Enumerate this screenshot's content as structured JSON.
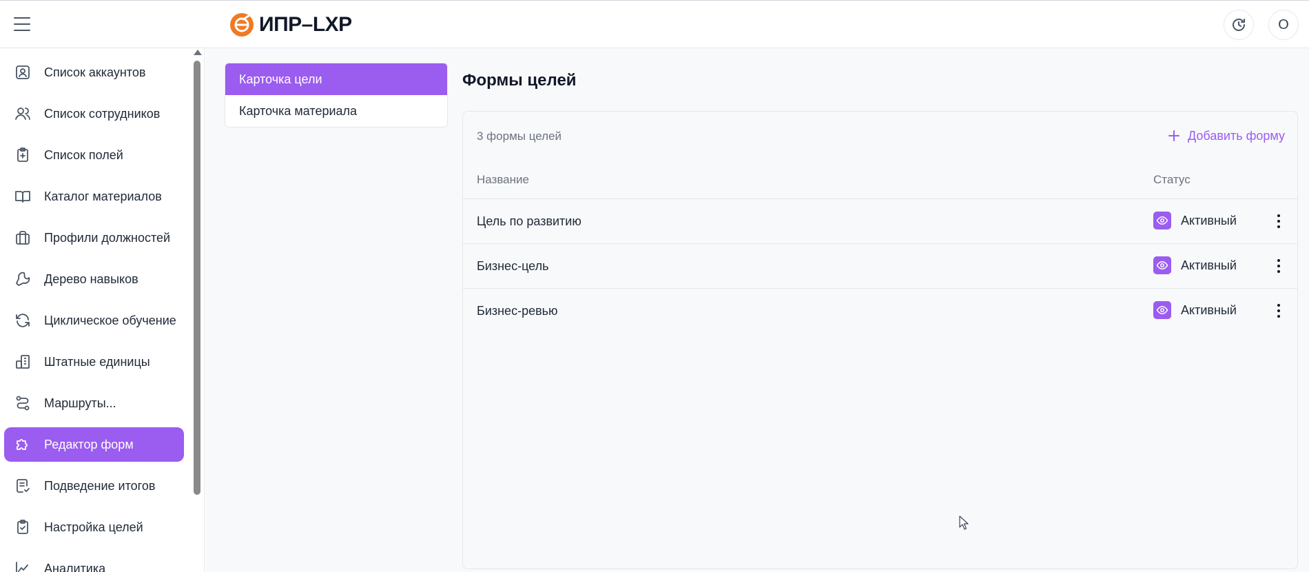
{
  "header": {
    "app_name": "ИПР–LXP",
    "brand_color": "#f07a24",
    "avatar_initial": "О",
    "menu_icon": "hamburger-icon",
    "history_icon": "history-clock-icon"
  },
  "sidebar": {
    "accent_color": "#9b5cf0",
    "items": [
      {
        "label": "Список аккаунтов",
        "icon": "account-card-icon"
      },
      {
        "label": "Список сотрудников",
        "icon": "users-icon"
      },
      {
        "label": "Список полей",
        "icon": "clipboard-plus-icon"
      },
      {
        "label": "Каталог материалов",
        "icon": "book-open-icon"
      },
      {
        "label": "Профили должностей",
        "icon": "briefcase-icon"
      },
      {
        "label": "Дерево навыков",
        "icon": "wrench-icon"
      },
      {
        "label": "Циклическое обучение",
        "icon": "refresh-icon"
      },
      {
        "label": "Штатные единицы",
        "icon": "buildings-icon"
      },
      {
        "label": "Маршруты...",
        "icon": "route-icon"
      },
      {
        "label": "Редактор форм",
        "icon": "puzzle-icon",
        "active": true
      },
      {
        "label": "Подведение итогов",
        "icon": "report-check-icon"
      },
      {
        "label": "Настройка целей",
        "icon": "clipboard-check-icon"
      },
      {
        "label": "Аналитика",
        "icon": "chart-line-icon"
      }
    ]
  },
  "submenu": {
    "items": [
      {
        "label": "Карточка цели",
        "active": true
      },
      {
        "label": "Карточка материала",
        "active": false
      }
    ]
  },
  "main": {
    "title": "Формы целей",
    "count_label": "3 формы целей",
    "add_label": "Добавить форму",
    "columns": {
      "name": "Название",
      "status": "Статус"
    },
    "rows": [
      {
        "name": "Цель по развитию",
        "status": "Активный"
      },
      {
        "name": "Бизнес-цель",
        "status": "Активный"
      },
      {
        "name": "Бизнес-ревью",
        "status": "Активный"
      }
    ]
  }
}
